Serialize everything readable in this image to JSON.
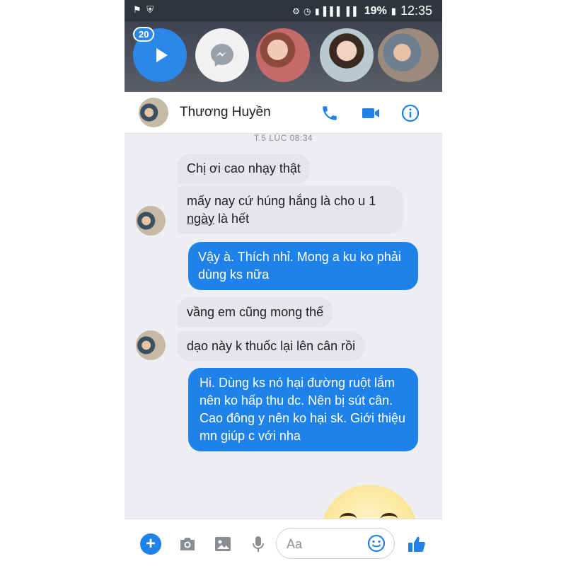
{
  "status_bar": {
    "battery": "19%",
    "time": "12:35"
  },
  "chat_heads": {
    "unread_badge": "20"
  },
  "conversation": {
    "contact_name": "Thương Huyền",
    "timestamp": "T.5 LÚC 08:34",
    "messages": [
      {
        "from": "them",
        "text": "Chị ơi cao nhạy thật"
      },
      {
        "from": "them",
        "text_before": "mấy nay cứ húng hắng là cho u 1 ",
        "text_underlined": "ngày",
        "text_after": " là hết"
      },
      {
        "from": "me",
        "text": "Vậy à. Thích nhỉ. Mong a ku ko phải dùng ks nữa"
      },
      {
        "from": "them",
        "text": "vầng em cũng mong thế"
      },
      {
        "from": "them",
        "text": "dạo này k thuốc lại lên cân rồi"
      },
      {
        "from": "me",
        "text": "Hi. Dùng ks nó hại đường ruột lắm nên ko hấp thu dc. Nên bị sút cân. Cao đông y nên ko hại sk. Giới thiệu mn giúp c với nha"
      }
    ]
  },
  "composer": {
    "placeholder": "Aa"
  },
  "colors": {
    "accent": "#1f82ea",
    "incoming_bubble": "#e4e6eb",
    "status_bar": "#2f343d"
  },
  "icons": [
    "phone-icon",
    "video-camera-icon",
    "info-icon",
    "plus-icon",
    "camera-icon",
    "gallery-icon",
    "microphone-icon",
    "emoji-icon",
    "thumbs-up-icon",
    "play-icon",
    "messenger-icon"
  ]
}
